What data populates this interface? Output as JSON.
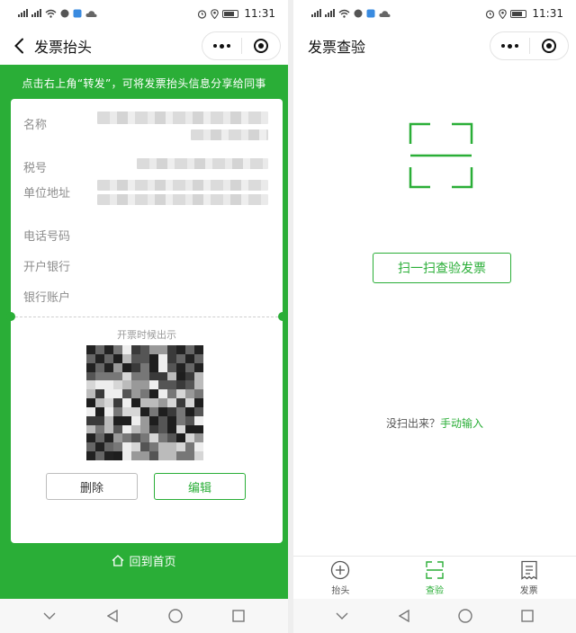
{
  "status_bar": {
    "time": "11:31"
  },
  "left_screen": {
    "title": "发票抬头",
    "hint": "点击右上角“转发”，可将发票抬头信息分享给同事",
    "fields": [
      {
        "label": "名称"
      },
      {
        "label": "税号"
      },
      {
        "label": "单位地址"
      },
      {
        "label": "电话号码"
      },
      {
        "label": "开户银行"
      },
      {
        "label": "银行账户"
      }
    ],
    "qr_caption": "开票时候出示",
    "delete_label": "删除",
    "edit_label": "编辑",
    "home_label": "回到首页"
  },
  "right_screen": {
    "title": "发票查验",
    "scan_button": "扫一扫查验发票",
    "manual_prefix": "没扫出来？",
    "manual_link": "手动输入",
    "tabs": [
      {
        "label": "抬头",
        "icon": "plus-circle-icon",
        "active": false
      },
      {
        "label": "查验",
        "icon": "scan-icon",
        "active": true
      },
      {
        "label": "发票",
        "icon": "receipt-icon",
        "active": false
      }
    ]
  },
  "colors": {
    "accent": "#2aae37",
    "card": "#ffffff",
    "label": "#8c8c8c"
  }
}
